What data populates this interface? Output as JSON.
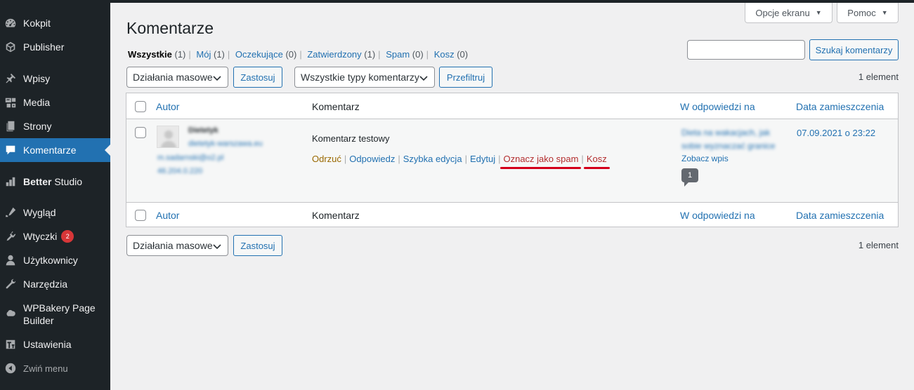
{
  "sidebar": {
    "items": [
      {
        "label": "Kokpit",
        "icon": "dashboard-icon"
      },
      {
        "label": "Publisher",
        "icon": "publisher-icon"
      },
      {
        "label": "Wpisy",
        "icon": "pin-icon"
      },
      {
        "label": "Media",
        "icon": "media-icon"
      },
      {
        "label": "Strony",
        "icon": "pages-icon"
      },
      {
        "label": "Komentarze",
        "icon": "comments-icon",
        "current": true
      },
      {
        "label_bold": "Better",
        "label_rest": " Studio",
        "icon": "better-studio-icon"
      },
      {
        "label": "Wygląd",
        "icon": "appearance-icon"
      },
      {
        "label": "Wtyczki",
        "icon": "plugins-icon",
        "badge": "2"
      },
      {
        "label": "Użytkownicy",
        "icon": "users-icon"
      },
      {
        "label": "Narzędzia",
        "icon": "tools-icon"
      },
      {
        "label": "WPBakery Page Builder",
        "icon": "wpbakery-icon"
      },
      {
        "label": "Ustawienia",
        "icon": "settings-icon"
      },
      {
        "label": "Zwiń menu",
        "icon": "collapse-icon"
      }
    ]
  },
  "screen_meta": {
    "options_label": "Opcje ekranu",
    "help_label": "Pomoc"
  },
  "page": {
    "title": "Komentarze",
    "filters": [
      {
        "label": "Wszystkie",
        "count": "(1)",
        "current": true
      },
      {
        "label": "Mój",
        "count": "(1)"
      },
      {
        "label": "Oczekujące",
        "count": "(0)"
      },
      {
        "label": "Zatwierdzony",
        "count": "(1)"
      },
      {
        "label": "Spam",
        "count": "(0)"
      },
      {
        "label": "Kosz",
        "count": "(0)"
      }
    ],
    "search": {
      "value": "",
      "button_label": "Szukaj komentarzy"
    },
    "bulk_actions": {
      "selected": "Działania masowe",
      "apply_label": "Zastosuj"
    },
    "type_filter": {
      "selected": "Wszystkie typy komentarzy",
      "filter_label": "Przefiltruj"
    },
    "items_count": "1 element"
  },
  "table": {
    "columns": [
      "Autor",
      "Komentarz",
      "W odpowiedzi na",
      "Data zamieszczenia"
    ],
    "row": {
      "author_name": "Dietetyk",
      "author_url": "dietetyk-warszawa.eu",
      "author_email": "m.sadarnski@o2.pl",
      "author_ip": "46.204.0.220",
      "comment": "Komentarz testowy",
      "actions": {
        "unapprove": "Odrzuć",
        "reply": "Odpowiedz",
        "quick_edit": "Szybka edycja",
        "edit": "Edytuj",
        "spam": "Oznacz jako spam",
        "trash": "Kosz"
      },
      "in_response_to": "Dieta na wakacjach, jak sobie wyznaczać granice",
      "view_post": "Zobacz wpis",
      "comment_count": "1",
      "date": "07.09.2021 o 23:22"
    }
  },
  "colors": {
    "sidebar_bg": "#1d2327",
    "accent": "#2271b1",
    "highlight_underline": "#d4001a"
  }
}
